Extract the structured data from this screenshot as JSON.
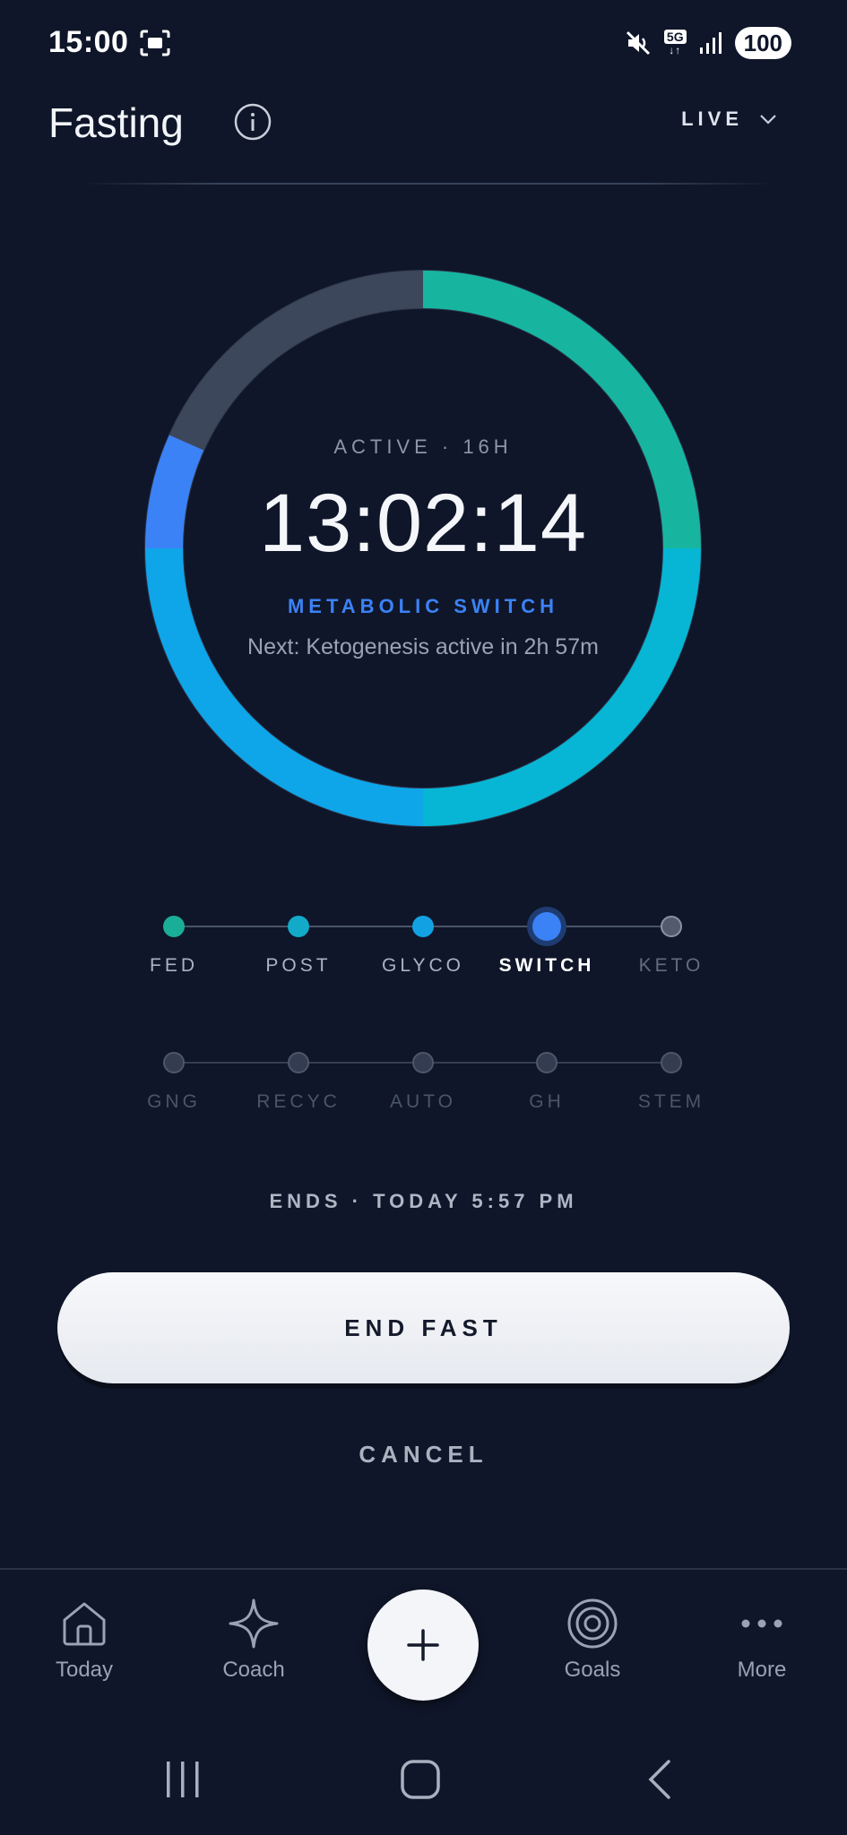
{
  "status_bar": {
    "time": "15:00",
    "network": "5G",
    "battery": "100"
  },
  "header": {
    "title": "Fasting",
    "mode_label": "LIVE"
  },
  "timer": {
    "status": "ACTIVE · 16H",
    "elapsed": "13:02:14",
    "phase": "METABOLIC SWITCH",
    "next": "Next: Ketogenesis active in 2h 57m"
  },
  "stages": {
    "row1": [
      {
        "label": "FED",
        "color": "#1aae98",
        "state": "done"
      },
      {
        "label": "POST",
        "color": "#13aac9",
        "state": "done"
      },
      {
        "label": "GLYCO",
        "color": "#12a2e4",
        "state": "done"
      },
      {
        "label": "SWITCH",
        "color": "#3b82f6",
        "state": "current"
      },
      {
        "label": "KETO",
        "color": "#525a6b",
        "state": "upcoming"
      }
    ],
    "row2": [
      {
        "label": "GNG"
      },
      {
        "label": "RECYC"
      },
      {
        "label": "AUTO"
      },
      {
        "label": "GH"
      },
      {
        "label": "STEM"
      }
    ]
  },
  "ends": "ENDS · TODAY 5:57 PM",
  "actions": {
    "end_fast": "END FAST",
    "cancel": "CANCEL"
  },
  "bottom_nav": {
    "items": [
      {
        "label": "Today",
        "icon": "home-icon"
      },
      {
        "label": "Coach",
        "icon": "sparkle-icon"
      },
      {
        "label": "Goals",
        "icon": "target-icon"
      },
      {
        "label": "More",
        "icon": "more-icon"
      }
    ],
    "fab_icon": "plus-icon"
  },
  "colors": {
    "background": "#0f1629",
    "accent_blue": "#3b82f6",
    "teal": "#1ab59c",
    "cyan": "#08b3d6",
    "ring_track": "#3d475c"
  },
  "progress": {
    "elapsed_fraction": 0.8136
  }
}
